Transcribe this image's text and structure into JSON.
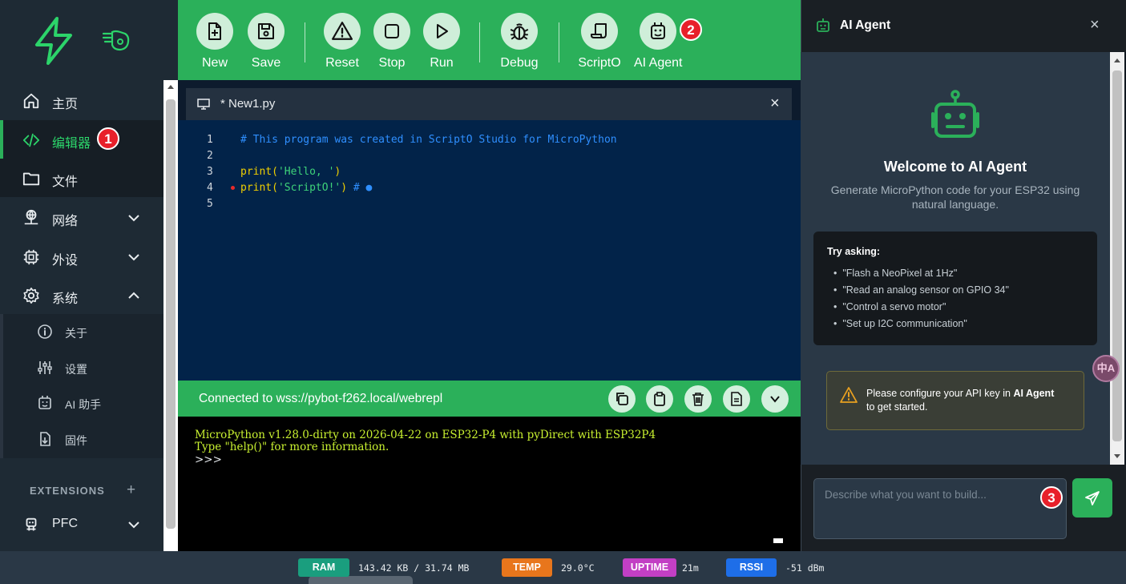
{
  "sidebar": {
    "items": [
      {
        "label": "主页",
        "icon": "home-icon"
      },
      {
        "label": "编辑器",
        "icon": "code-icon",
        "badge": "1"
      },
      {
        "label": "文件",
        "icon": "folder-icon"
      },
      {
        "label": "网络",
        "icon": "network-icon"
      },
      {
        "label": "外设",
        "icon": "chip-icon"
      },
      {
        "label": "系统",
        "icon": "gear-icon"
      }
    ],
    "sub_items": [
      {
        "label": "关于",
        "icon": "info-icon"
      },
      {
        "label": "设置",
        "icon": "sliders-icon"
      },
      {
        "label": "AI 助手",
        "icon": "robot-icon"
      },
      {
        "label": "固件",
        "icon": "download-icon"
      }
    ],
    "extensions_label": "EXTENSIONS",
    "extensions_add": "+",
    "pfc_label": "PFC"
  },
  "toolbar": {
    "new_label": "New",
    "save_label": "Save",
    "reset_label": "Reset",
    "stop_label": "Stop",
    "run_label": "Run",
    "debug_label": "Debug",
    "scripto_label": "ScriptO",
    "ai_agent_label": "AI Agent",
    "ai_badge": "2"
  },
  "editor": {
    "tab_title": "* New1.py",
    "close": "×",
    "lines": [
      {
        "n": "1",
        "text": "# This program was created in ScriptO Studio for MicroPython"
      },
      {
        "n": "2",
        "text": ""
      },
      {
        "n": "3",
        "text": "print('Hello, ')"
      },
      {
        "n": "4",
        "text": "print('ScriptO!') # ●"
      },
      {
        "n": "5",
        "text": ""
      }
    ],
    "line3_fn": "print(",
    "line3_str": "'Hello, '",
    "line3_end": ")",
    "line4_fn": "print(",
    "line4_str": "'ScriptO!'",
    "line4_end": ")",
    "line4_comment": " # ●"
  },
  "terminal": {
    "status": "Connected to wss://pybot-f262.local/webrepl",
    "line1": "MicroPython v1.28.0-dirty on 2026-04-22 on ESP32-P4 with pyDirect with ESP32P4",
    "line2": "Type \"help()\" for more information.",
    "line3": ">>>"
  },
  "ai": {
    "title": "AI Agent",
    "close": "×",
    "welcome": "Welcome to AI Agent",
    "subtitle1": "Generate MicroPython code for your ESP32 using",
    "subtitle2": "natural language.",
    "try_title": "Try asking:",
    "suggestions": [
      "\"Flash a NeoPixel at 1Hz\"",
      "\"Read an analog sensor on GPIO 34\"",
      "\"Control a servo motor\"",
      "\"Set up I2C communication\""
    ],
    "warn_pre": "Please configure your API key in ",
    "warn_bold": "AI Agent",
    "warn_post": "to get started.",
    "input_placeholder": "Describe what you want to build...",
    "input_badge": "3",
    "float_glyph": "中A"
  },
  "status": {
    "ram_label": "RAM",
    "ram_value": "143.42 KB / 31.74 MB",
    "temp_label": "TEMP",
    "temp_value": "29.0°C",
    "uptime_label": "UPTIME",
    "uptime_value": "21m",
    "rssi_label": "RSSI",
    "rssi_value": "-51 dBm"
  },
  "colors": {
    "accent": "#2bb05a",
    "sidebar": "#1e2a34",
    "editor_bg": "#022349",
    "comment": "#2f8fff",
    "keyword": "#f0d000",
    "string": "#3ed37a",
    "ram": "#1a9e7e",
    "temp": "#e8761c",
    "uptime": "#c23fc4",
    "rssi": "#1e6ee8"
  }
}
